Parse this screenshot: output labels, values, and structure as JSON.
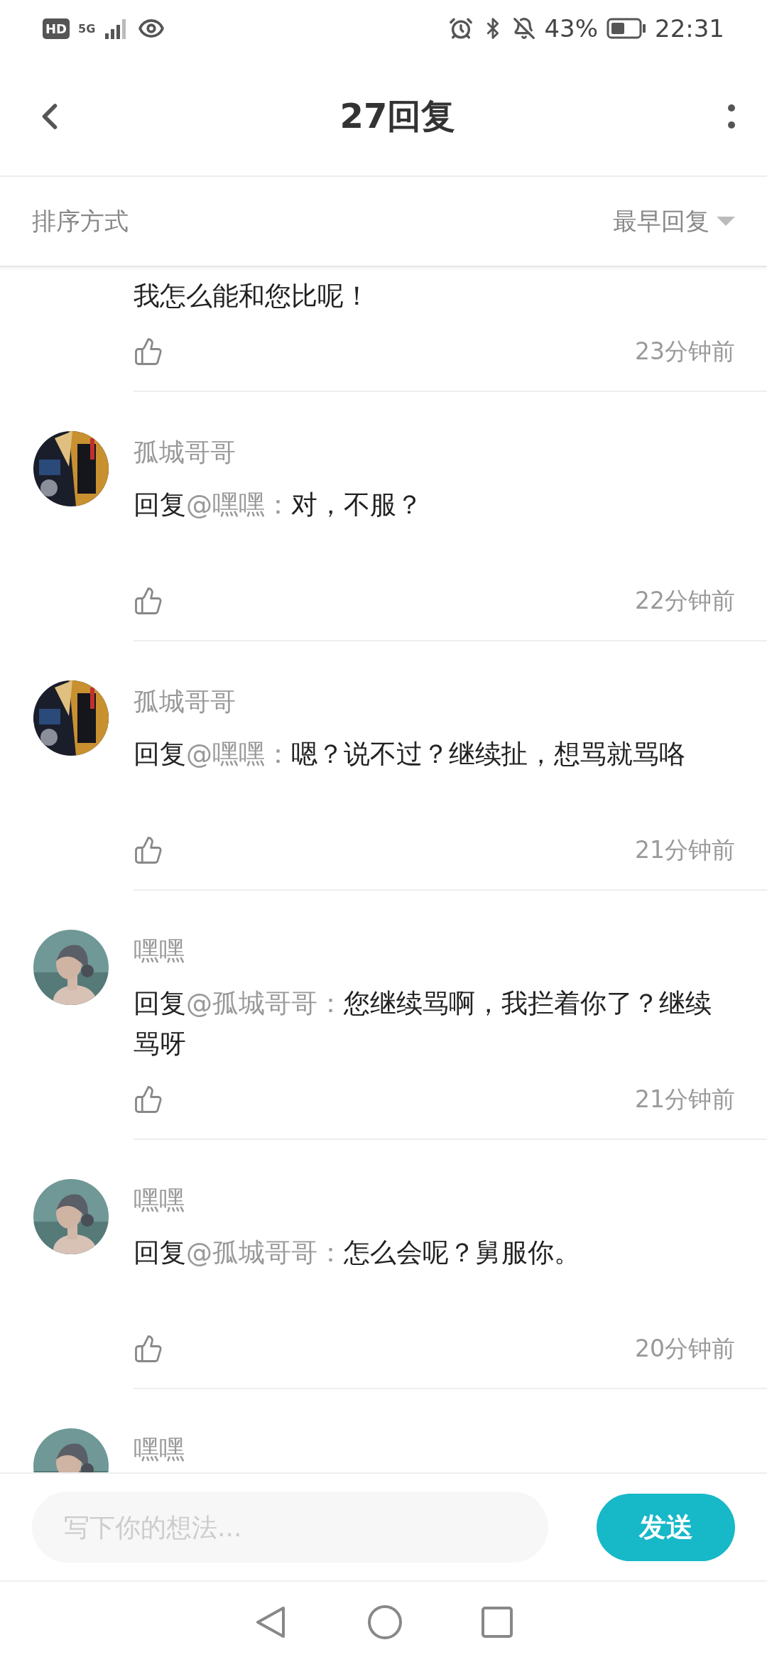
{
  "status_bar": {
    "hd": "HD",
    "network": "5G",
    "battery": "43%",
    "time": "22:31"
  },
  "header": {
    "title": "27回复"
  },
  "sort_bar": {
    "label": "排序方式",
    "value": "最早回复"
  },
  "cut_reply": {
    "text": "我怎么能和您比呢！",
    "time": "23分钟前"
  },
  "replies": [
    {
      "author": "孤城哥哥",
      "prefix": "回复",
      "mention": "@嘿嘿：",
      "text": "对，不服？",
      "time": "22分钟前"
    },
    {
      "author": "孤城哥哥",
      "prefix": "回复",
      "mention": "@嘿嘿：",
      "text": "嗯？说不过？继续扯，想骂就骂咯",
      "time": "21分钟前"
    },
    {
      "author": "嘿嘿",
      "prefix": "回复",
      "mention": "@孤城哥哥：",
      "text": "您继续骂啊，我拦着你了？继续骂呀",
      "time": "21分钟前"
    },
    {
      "author": "嘿嘿",
      "prefix": "回复",
      "mention": "@孤城哥哥：",
      "text": "怎么会呢？舅服你。",
      "time": "20分钟前"
    },
    {
      "author": "嘿嘿"
    }
  ],
  "composer": {
    "placeholder": "写下你的想法...",
    "send": "发送"
  }
}
